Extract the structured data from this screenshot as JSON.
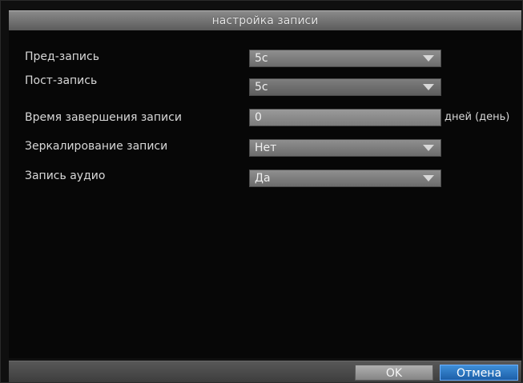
{
  "dialog": {
    "title": "настройка записи"
  },
  "settings": [
    {
      "label": "Пред-запись",
      "value": "5с",
      "kind": "select"
    },
    {
      "label": "Пост-запись",
      "value": "5с",
      "kind": "select"
    },
    {
      "label": "Время завершения записи",
      "value": "0",
      "kind": "input",
      "unit": "дней (день)"
    },
    {
      "label": "Зеркалирование записи",
      "value": "Нет",
      "kind": "select"
    },
    {
      "label": "Запись аудио",
      "value": "Да",
      "kind": "select"
    }
  ],
  "footer": {
    "ok_label": "OK",
    "cancel_label": "Отмена"
  },
  "colors": {
    "cancel_accent": "#2a78c8",
    "title_bar": "#6e6e6e",
    "background": "#070707"
  },
  "icons": {
    "dropdown": "chevron-down-icon"
  }
}
